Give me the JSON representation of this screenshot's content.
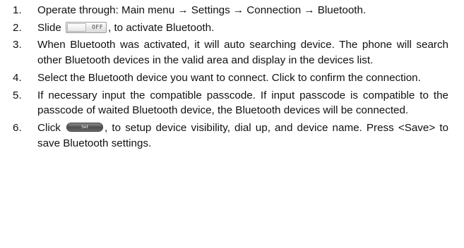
{
  "steps": [
    {
      "num": "1.",
      "text": "Operate through: Main menu → Settings → Connection → Bluetooth."
    },
    {
      "num": "2.",
      "before": "Slide",
      "toggle_label": "OFF",
      "after": ", to activate Bluetooth."
    },
    {
      "num": "3.",
      "text": "When Bluetooth was activated, it will auto searching device. The phone will search other Bluetooth devices in the valid area and display in the devices list."
    },
    {
      "num": "4.",
      "text": "Select the Bluetooth device you want to connect. Click to confirm the connection."
    },
    {
      "num": "5.",
      "text": "If necessary input the compatible passcode. If input passcode is compatible to the passcode of waited Bluetooth device, the Bluetooth devices will be connected."
    },
    {
      "num": "6.",
      "before": "Click",
      "button_label": "Set",
      "after": ", to setup device visibility, dial up, and device name. Press <Save> to save Bluetooth settings."
    }
  ]
}
